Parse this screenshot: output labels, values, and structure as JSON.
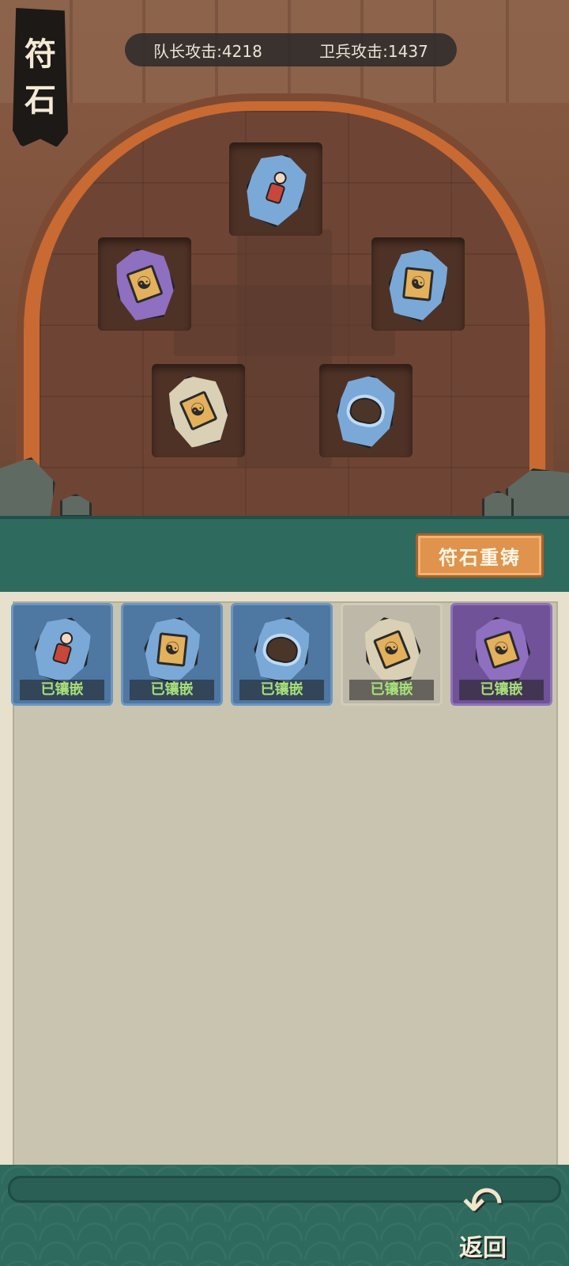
{
  "title": {
    "chars": [
      "符",
      "石"
    ]
  },
  "stats": {
    "captain_attack": "队长攻击:4218",
    "guard_attack": "卫兵攻击:1437"
  },
  "board_slots": [
    {
      "id": "top",
      "rune": "blue-figure-rune"
    },
    {
      "id": "left",
      "rune": "purple-yinyang-rune"
    },
    {
      "id": "right",
      "rune": "blue-yinyang-rune"
    },
    {
      "id": "bottom-left",
      "rune": "beige-yinyang-rune"
    },
    {
      "id": "bottom-right",
      "rune": "blue-creature-rune"
    }
  ],
  "recast_button": {
    "label": "符石重铸"
  },
  "inventory": [
    {
      "rune": "blue-figure-rune",
      "color": "#4e77a2",
      "status": "已镶嵌"
    },
    {
      "rune": "blue-yinyang-rune",
      "color": "#4e77a2",
      "status": "已镶嵌"
    },
    {
      "rune": "blue-creature-rune",
      "color": "#4e77a2",
      "status": "已镶嵌"
    },
    {
      "rune": "beige-yinyang-rune",
      "color": "#bdb8a8",
      "status": "已镶嵌"
    },
    {
      "rune": "purple-yinyang-rune",
      "color": "#6f5298",
      "status": "已镶嵌"
    }
  ],
  "back_button": {
    "label": "返回",
    "icon": "back-arrow-icon"
  },
  "colors": {
    "teal": "#2f6a5e",
    "accent_orange": "#e0934c",
    "status_green": "#a7e07a"
  }
}
